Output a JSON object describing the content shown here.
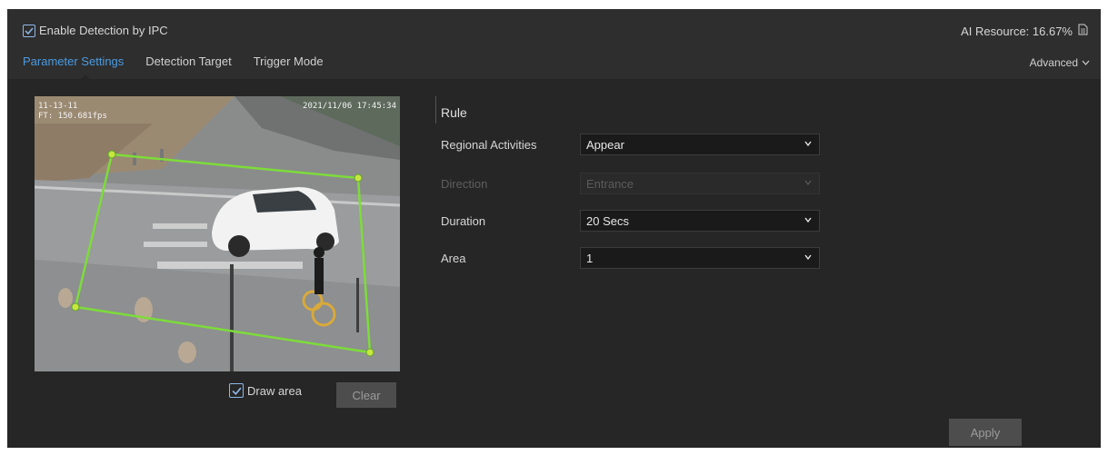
{
  "header": {
    "enable_label": "Enable Detection by IPC",
    "enable_checked": true,
    "ai_resource": "AI Resource: 16.67%"
  },
  "tabs": [
    {
      "label": "Parameter Settings",
      "active": true
    },
    {
      "label": "Detection Target",
      "active": false
    },
    {
      "label": "Trigger Mode",
      "active": false
    }
  ],
  "advanced_label": "Advanced",
  "video": {
    "osd_left_1": "11-13-11",
    "osd_left_2": "FT: 150.681fps",
    "osd_timestamp": "2021/11/06 17:45:34"
  },
  "draw_area": {
    "label": "Draw area",
    "checked": true
  },
  "clear_label": "Clear",
  "rule": {
    "title": "Rule",
    "fields": [
      {
        "label": "Regional Activities",
        "value": "Appear",
        "disabled": false
      },
      {
        "label": "Direction",
        "value": "Entrance",
        "disabled": true
      },
      {
        "label": "Duration",
        "value": "20 Secs",
        "disabled": false
      },
      {
        "label": "Area",
        "value": "1",
        "disabled": false
      }
    ]
  },
  "apply_label": "Apply",
  "colors": {
    "accent": "#4a9be0",
    "panel": "#262626",
    "region": "#7ddc3a"
  }
}
